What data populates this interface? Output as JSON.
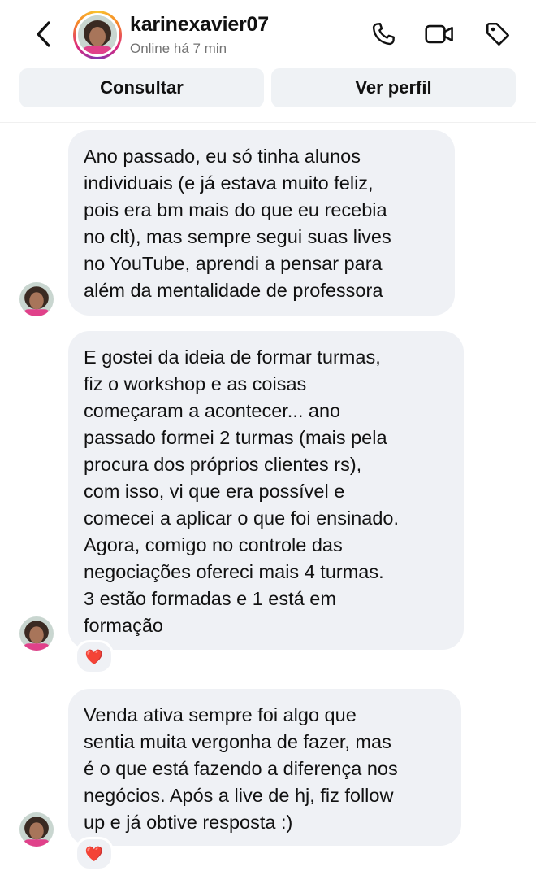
{
  "header": {
    "username": "karinexavier07",
    "status": "Online há 7 min",
    "back_icon": "chevron-left-icon",
    "call_icon": "phone-icon",
    "video_icon": "video-camera-icon",
    "tag_icon": "tag-icon"
  },
  "actions": {
    "consult_label": "Consultar",
    "profile_label": "Ver perfil"
  },
  "messages": [
    {
      "text": "Ano passado, eu só tinha alunos\nindividuais (e já estava muito feliz,\npois era bm mais do que eu recebia\nno clt), mas sempre segui suas lives\nno YouTube, aprendi a pensar para\nalém da mentalidade de professora",
      "reaction": ""
    },
    {
      "text": "E gostei da ideia de formar turmas,\nfiz o workshop e as coisas\ncomeçaram a acontecer... ano\npassado formei 2 turmas (mais pela\nprocura dos próprios clientes rs),\ncom isso, vi que era possível e\ncomecei a aplicar o que foi ensinado.\nAgora, comigo no controle das\nnegociações ofereci mais 4 turmas.\n3 estão formadas e 1 está em\nformação",
      "reaction": "❤️"
    },
    {
      "text": "Venda ativa sempre foi algo que\nsentia muita vergonha de fazer, mas\né o que está fazendo a diferença nos\nnegócios. Após a live de hj, fiz follow\nup e já obtive resposta  :)",
      "reaction": "❤️"
    }
  ],
  "colors": {
    "bubble": "#eff1f5",
    "button": "#eff2f5",
    "status_text": "#737373",
    "reaction_heart": "#e0245e"
  }
}
